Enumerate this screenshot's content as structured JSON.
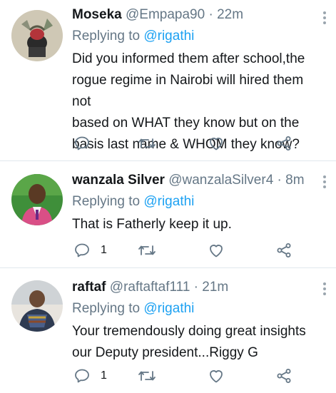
{
  "tweets": [
    {
      "name": "Moseka",
      "handle": "@Empapa90",
      "time": "22m",
      "replying_prefix": "Replying to",
      "replying_to": "@rigathi",
      "text_lines": [
        "Did you informed them after school,the",
        "rogue regime in Nairobi will hired them not",
        "based on WHAT they know but on the",
        "basis last name & WHOM they know?"
      ],
      "reply_count": ""
    },
    {
      "name": "wanzala Silver",
      "handle": "@wanzalaSilver4",
      "time": "8m",
      "replying_prefix": "Replying to",
      "replying_to": "@rigathi",
      "text_lines": [
        "That is Fatherly keep it up."
      ],
      "reply_count": "1"
    },
    {
      "name": "raftaf",
      "handle": "@raftaftaf111",
      "time": "21m",
      "replying_prefix": "Replying to",
      "replying_to": "@rigathi",
      "text_lines": [
        "Your tremendously doing great insights",
        "our Deputy president...Riggy G"
      ],
      "reply_count": "1"
    }
  ],
  "separator": "·",
  "icons": {
    "reply": "reply-icon",
    "retweet": "retweet-icon",
    "like": "heart-icon",
    "share": "share-icon",
    "more": "more-vertical-icon"
  },
  "colors": {
    "accent": "#1da1f2",
    "secondary_text": "#657786",
    "divider": "#e1e8ed"
  }
}
